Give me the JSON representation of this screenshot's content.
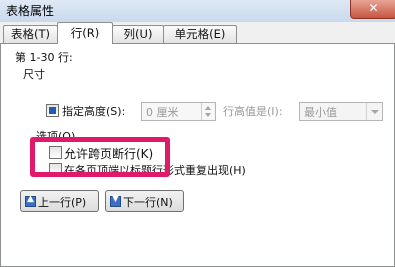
{
  "window": {
    "title": "表格属性",
    "close_glyph": "✕"
  },
  "tabs": [
    {
      "label": "表格(T)",
      "active": false
    },
    {
      "label": "行(R)",
      "active": true
    },
    {
      "label": "列(U)",
      "active": false
    },
    {
      "label": "单元格(E)",
      "active": false
    }
  ],
  "rows_label": "第 1-30 行:",
  "size": {
    "section_label": "尺寸",
    "specify_height": {
      "label": "指定高度(S):",
      "checked": true
    },
    "height_value": "0 厘米",
    "row_height_is_label": "行高值是(I):",
    "row_height_mode": "最小值"
  },
  "options": {
    "section_label": "选项(O)",
    "allow_break": {
      "label": "允许跨页断行(K)",
      "checked": false
    },
    "repeat_header": {
      "label": "在各页顶端以标题行形式重复出现(H)",
      "checked": false
    }
  },
  "nav": {
    "prev_label": "上一行(P)",
    "prev_glyph": "▲",
    "next_label": "下一行(N)",
    "next_glyph": "▼"
  },
  "colors": {
    "highlight": "#e2196b",
    "accent": "#1e5cb3"
  }
}
